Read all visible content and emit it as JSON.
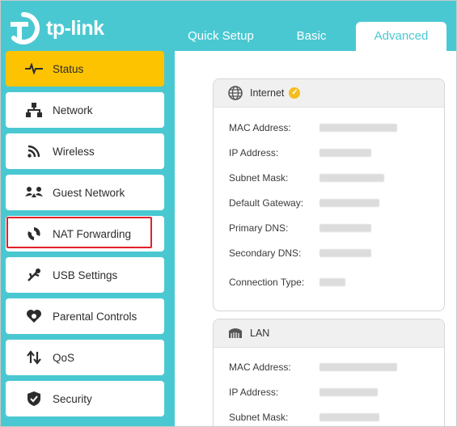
{
  "brand": {
    "name": "tp-link"
  },
  "tabs": {
    "quick": "Quick Setup",
    "basic": "Basic",
    "advanced": "Advanced"
  },
  "sidebar": {
    "items": [
      {
        "label": "Status",
        "icon": "pulse-icon"
      },
      {
        "label": "Network",
        "icon": "network-icon"
      },
      {
        "label": "Wireless",
        "icon": "wifi-icon"
      },
      {
        "label": "Guest Network",
        "icon": "guest-network-icon"
      },
      {
        "label": "NAT Forwarding",
        "icon": "nat-forwarding-icon"
      },
      {
        "label": "USB Settings",
        "icon": "usb-icon"
      },
      {
        "label": "Parental Controls",
        "icon": "parental-controls-icon"
      },
      {
        "label": "QoS",
        "icon": "qos-icon"
      },
      {
        "label": "Security",
        "icon": "shield-icon"
      }
    ]
  },
  "internet": {
    "title": "Internet",
    "labels": {
      "mac": "MAC Address:",
      "ip": "IP Address:",
      "subnet": "Subnet Mask:",
      "gateway": "Default Gateway:",
      "dns1": "Primary DNS:",
      "dns2": "Secondary DNS:",
      "conn": "Connection Type:"
    }
  },
  "lan": {
    "title": "LAN",
    "labels": {
      "mac": "MAC Address:",
      "ip": "IP Address:",
      "subnet": "Subnet Mask:"
    }
  },
  "colors": {
    "accent": "#4ac8d2",
    "active": "#fdc300",
    "highlight": "#e0202a",
    "check": "#f4bd1c"
  }
}
